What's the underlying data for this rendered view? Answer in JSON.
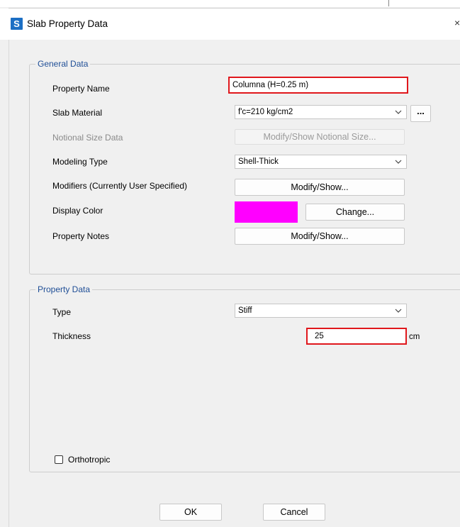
{
  "window": {
    "title": "Slab Property Data",
    "app_icon_letter": "S",
    "close_glyph": "×"
  },
  "general": {
    "legend": "General Data",
    "property_name_label": "Property Name",
    "property_name_value": "Columna (H=0.25 m)",
    "slab_material_label": "Slab Material",
    "slab_material_value": "f'c=210 kg/cm2",
    "material_more_label": "...",
    "notional_label": "Notional Size Data",
    "notional_button": "Modify/Show Notional Size...",
    "modeling_type_label": "Modeling Type",
    "modeling_type_value": "Shell-Thick",
    "modifiers_label": "Modifiers (Currently User Specified)",
    "modifiers_button": "Modify/Show...",
    "display_color_label": "Display Color",
    "display_color_value": "#ff00ff",
    "change_button": "Change...",
    "notes_label": "Property Notes",
    "notes_button": "Modify/Show..."
  },
  "property": {
    "legend": "Property Data",
    "type_label": "Type",
    "type_value": "Stiff",
    "thickness_label": "Thickness",
    "thickness_value": "25",
    "thickness_unit": "cm",
    "orthotropic_label": "Orthotropic",
    "orthotropic_checked": false
  },
  "buttons": {
    "ok": "OK",
    "cancel": "Cancel"
  },
  "colors": {
    "highlight_red": "#e0171c",
    "legend_blue": "#1f4e96"
  }
}
